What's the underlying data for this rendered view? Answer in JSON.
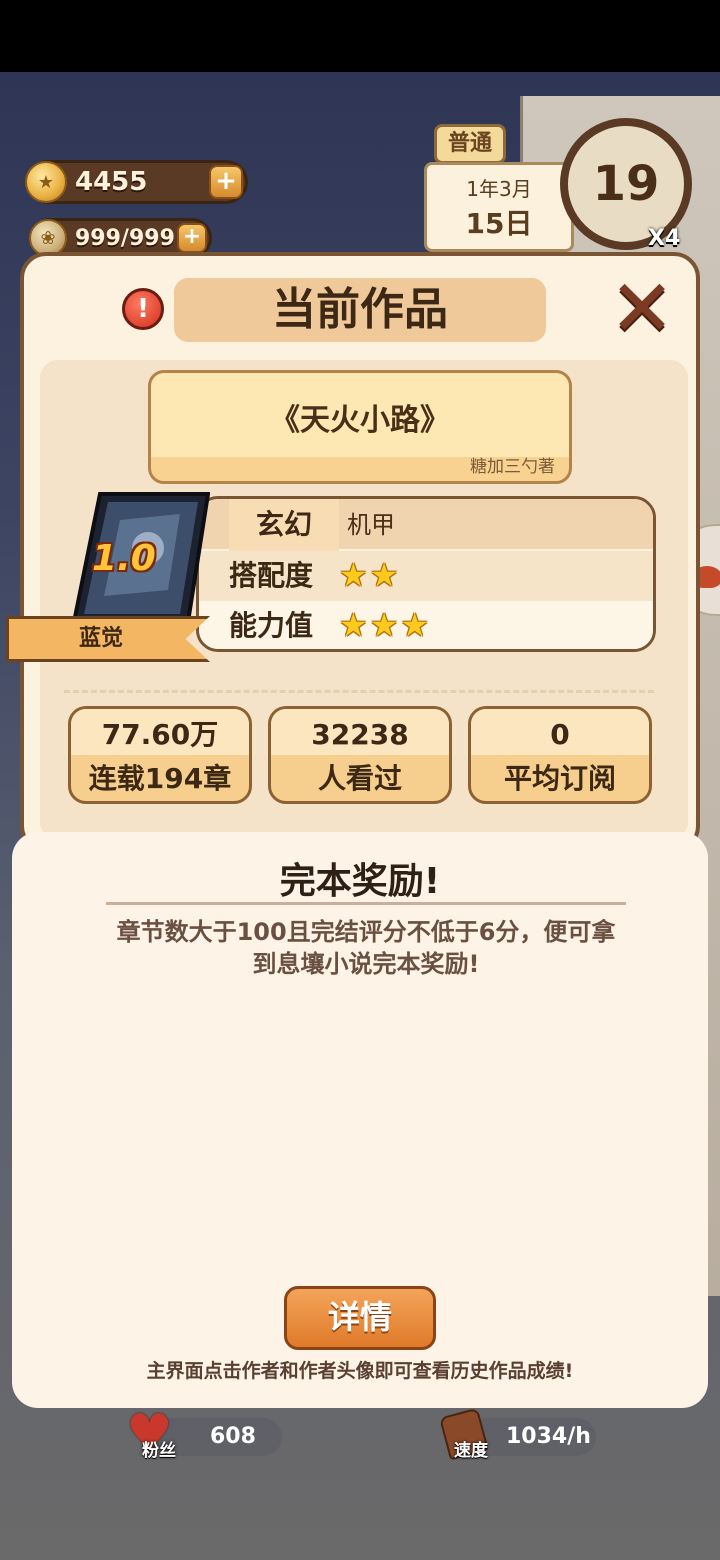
{
  "hud": {
    "coins": "4455",
    "energy": "999/999",
    "mode": "普通",
    "date_ym": "1年3月",
    "date_day": "15日",
    "clock": "19",
    "speed_multiplier": "X4"
  },
  "dialog": {
    "title": "当前作品",
    "book_title": "《天火小路》",
    "author_credit": "糖加三勺著",
    "genre_main": "玄幻",
    "genre_sub": "机甲",
    "match_label": "搭配度",
    "match_stars": 2,
    "ability_label": "能力值",
    "ability_stars": 3,
    "rating": "1.0",
    "author_name": "蓝觉",
    "stats": [
      {
        "value": "77.60万",
        "label": "连载194章"
      },
      {
        "value": "32238",
        "label": "人看过"
      },
      {
        "value": "0",
        "label": "平均订阅"
      }
    ]
  },
  "reward": {
    "title": "完本奖励!",
    "description": "章节数大于100且完结评分不低于6分，便可拿到息壤小说完本奖励!",
    "detail_button": "详情",
    "hint": "主界面点击作者和作者头像即可查看历史作品成绩!"
  },
  "bottom": {
    "fans_label": "粉丝",
    "fans_value": "608",
    "speed_label": "速度",
    "speed_value": "1034/h"
  },
  "icons": {
    "warning": "warning-icon",
    "close": "close-icon",
    "star": "star-icon",
    "coin": "coin-icon",
    "plus": "plus-icon",
    "heart": "heart-icon",
    "speed": "speed-icon"
  }
}
